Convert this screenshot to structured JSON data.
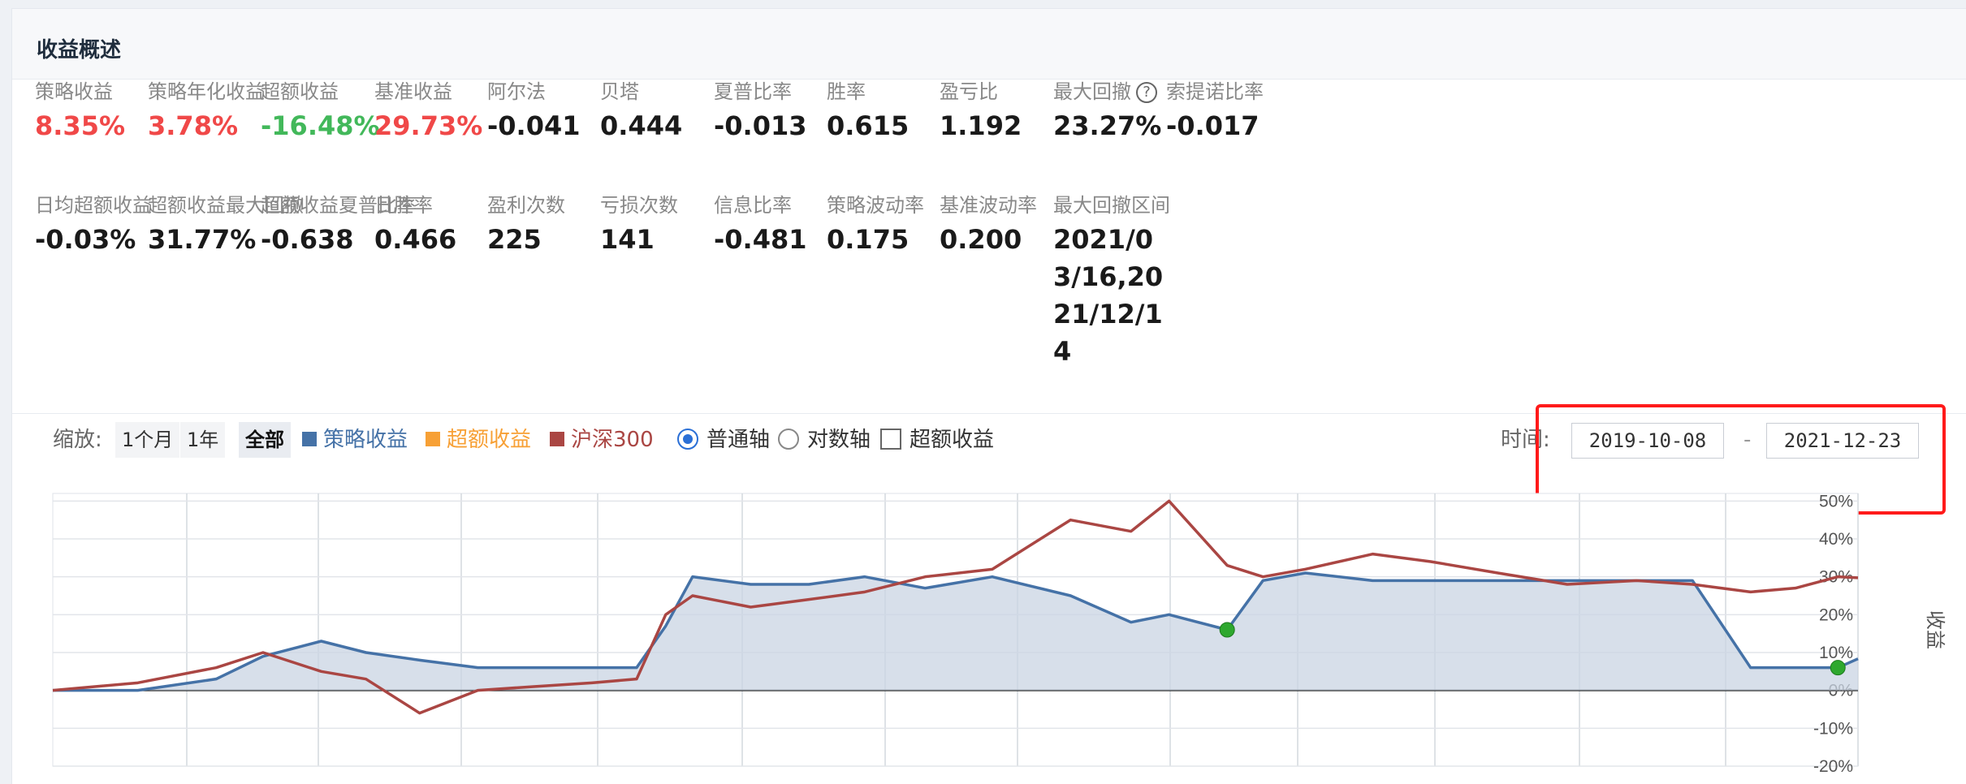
{
  "header": {
    "title": "收益概述"
  },
  "metrics_row1": [
    {
      "label": "策略收益",
      "value": "8.35%",
      "tone": "red"
    },
    {
      "label": "策略年化收益",
      "value": "3.78%",
      "tone": "red"
    },
    {
      "label": "超额收益",
      "value": "-16.48%",
      "tone": "green"
    },
    {
      "label": "基准收益",
      "value": "29.73%",
      "tone": "red"
    },
    {
      "label": "阿尔法",
      "value": "-0.041",
      "tone": ""
    },
    {
      "label": "贝塔",
      "value": "0.444",
      "tone": ""
    },
    {
      "label": "夏普比率",
      "value": "-0.013",
      "tone": ""
    },
    {
      "label": "胜率",
      "value": "0.615",
      "tone": ""
    },
    {
      "label": "盈亏比",
      "value": "1.192",
      "tone": ""
    },
    {
      "label": "最大回撤",
      "value": "23.27%",
      "tone": ""
    },
    {
      "label": "索提诺比率",
      "value": "-0.017",
      "tone": ""
    }
  ],
  "metrics_row2": [
    {
      "label": "日均超额收益",
      "value": "-0.03%"
    },
    {
      "label": "超额收益最大回撤",
      "value": "31.77%"
    },
    {
      "label": "超额收益夏普比率",
      "value": "-0.638"
    },
    {
      "label": "日胜率",
      "value": "0.466"
    },
    {
      "label": "盈利次数",
      "value": "225"
    },
    {
      "label": "亏损次数",
      "value": "141"
    },
    {
      "label": "信息比率",
      "value": "-0.481"
    },
    {
      "label": "策略波动率",
      "value": "0.175"
    },
    {
      "label": "基准波动率",
      "value": "0.200"
    },
    {
      "label": "最大回撤区间",
      "value": "2021/03/16,2021/12/14"
    }
  ],
  "toolbar": {
    "zoom_label": "缩放:",
    "zoom_buttons": [
      "1个月",
      "1年",
      "全部"
    ],
    "zoom_active": "全部",
    "legend": [
      {
        "name": "策略收益",
        "color": "#4572a7"
      },
      {
        "name": "超额收益",
        "color": "#f7a035"
      },
      {
        "name": "沪深300",
        "color": "#aa4643"
      }
    ],
    "axis_options": [
      "普通轴",
      "对数轴"
    ],
    "axis_selected": "普通轴",
    "excess_checkbox_label": "超额收益",
    "time_label": "时间:",
    "date_from": "2019-10-08",
    "date_to": "2021-12-23",
    "date_separator": "-"
  },
  "chart_data": {
    "type": "line",
    "ylabel": "收益",
    "y_ticks": [
      "50%",
      "40%",
      "30%",
      "20%",
      "10%",
      "0%",
      "-10%",
      "-20%"
    ],
    "ylim": [
      -20,
      52
    ],
    "xlim": [
      "2019-10-08",
      "2021-12-23"
    ],
    "series": [
      {
        "name": "策略收益",
        "color": "#4572a7",
        "x": [
          "2019-10-08",
          "2019-11-15",
          "2019-12-20",
          "2020-01-10",
          "2020-02-05",
          "2020-02-25",
          "2020-03-20",
          "2020-04-15",
          "2020-05-10",
          "2020-06-05",
          "2020-06-25",
          "2020-07-08",
          "2020-07-20",
          "2020-08-15",
          "2020-09-10",
          "2020-10-05",
          "2020-11-01",
          "2020-12-01",
          "2021-01-05",
          "2021-02-01",
          "2021-02-18",
          "2021-03-16",
          "2021-04-01",
          "2021-04-20",
          "2021-05-20",
          "2021-06-15",
          "2021-07-15",
          "2021-08-15",
          "2021-09-15",
          "2021-10-10",
          "2021-11-05",
          "2021-11-25",
          "2021-12-14",
          "2021-12-23"
        ],
        "values": [
          0,
          0,
          3,
          9,
          13,
          10,
          8,
          6,
          6,
          6,
          6,
          17,
          30,
          28,
          28,
          30,
          27,
          30,
          25,
          18,
          20,
          16,
          29,
          31,
          29,
          29,
          29,
          29,
          29,
          29,
          6,
          6,
          6,
          8.35
        ]
      },
      {
        "name": "沪深300",
        "color": "#aa4643",
        "x": [
          "2019-10-08",
          "2019-11-15",
          "2019-12-20",
          "2020-01-10",
          "2020-02-05",
          "2020-02-25",
          "2020-03-20",
          "2020-04-15",
          "2020-05-10",
          "2020-06-05",
          "2020-06-25",
          "2020-07-08",
          "2020-07-20",
          "2020-08-15",
          "2020-09-10",
          "2020-10-05",
          "2020-11-01",
          "2020-12-01",
          "2021-01-05",
          "2021-02-01",
          "2021-02-18",
          "2021-03-16",
          "2021-04-01",
          "2021-04-20",
          "2021-05-20",
          "2021-06-15",
          "2021-07-15",
          "2021-08-15",
          "2021-09-15",
          "2021-10-10",
          "2021-11-05",
          "2021-11-25",
          "2021-12-14",
          "2021-12-23"
        ],
        "values": [
          0,
          2,
          6,
          10,
          5,
          3,
          -6,
          0,
          1,
          2,
          3,
          20,
          25,
          22,
          24,
          26,
          30,
          32,
          45,
          42,
          50,
          33,
          30,
          32,
          36,
          34,
          31,
          28,
          29,
          28,
          26,
          27,
          30,
          29.73
        ]
      }
    ],
    "max_drawdown_markers": [
      "2021-03-16",
      "2021-12-14"
    ]
  }
}
